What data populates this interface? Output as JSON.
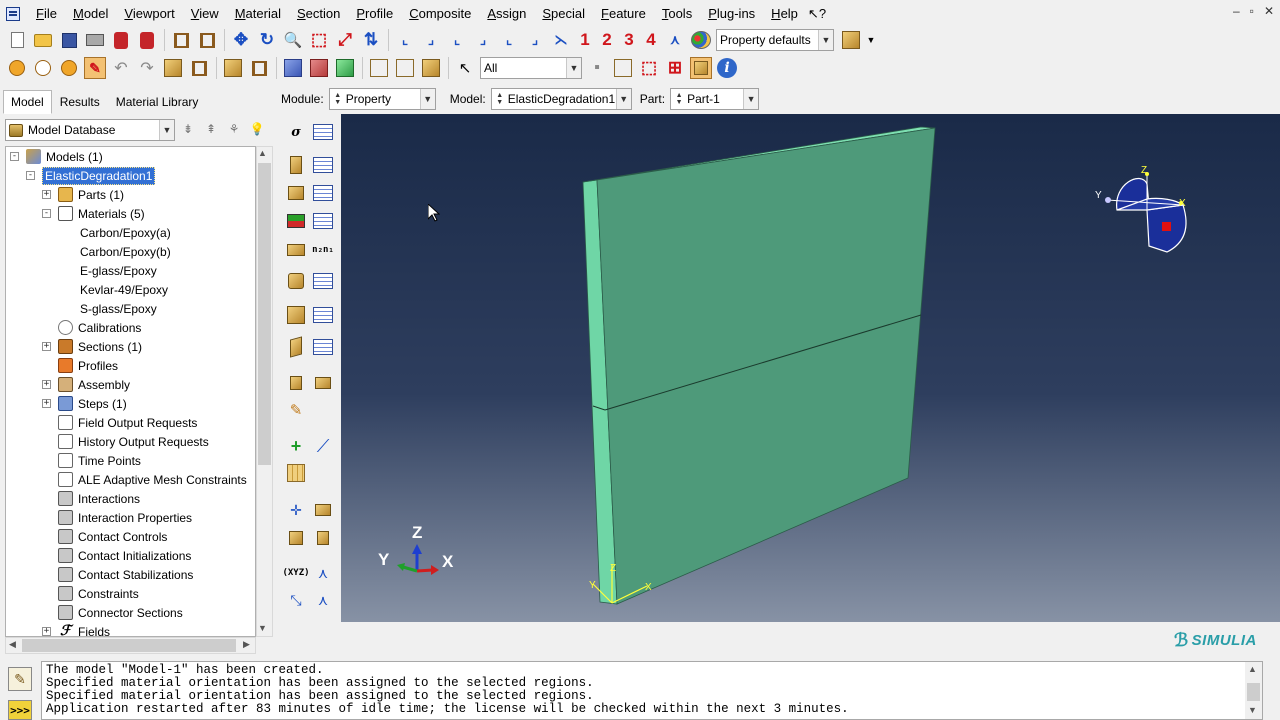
{
  "window": {
    "controls": [
      "–",
      "▫",
      "✕"
    ]
  },
  "menu": {
    "items": [
      "File",
      "Model",
      "Viewport",
      "View",
      "Material",
      "Section",
      "Profile",
      "Composite",
      "Assign",
      "Special",
      "Feature",
      "Tools",
      "Plug-ins",
      "Help"
    ],
    "help_arrow": "?"
  },
  "toolbar1": {
    "number_buttons": [
      "1",
      "2",
      "3",
      "4"
    ],
    "render_style": "Property defaults"
  },
  "toolbar2": {
    "selection_filter": "All"
  },
  "left_panel": {
    "tabs": [
      "Model",
      "Results",
      "Material Library"
    ],
    "active_tab": 0,
    "database_combo": "Model Database"
  },
  "tree": {
    "nodes": [
      {
        "label": "Models (1)",
        "level": 0,
        "expander": "-",
        "icon": "models"
      },
      {
        "label": "ElasticDegradation1",
        "level": 1,
        "expander": "-",
        "icon": "",
        "selected": true
      },
      {
        "label": "Parts (1)",
        "level": 2,
        "expander": "+",
        "icon": "parts"
      },
      {
        "label": "Materials (5)",
        "level": 2,
        "expander": "-",
        "icon": "materials"
      },
      {
        "label": "Carbon/Epoxy(a)",
        "level": 3,
        "expander": "",
        "icon": ""
      },
      {
        "label": "Carbon/Epoxy(b)",
        "level": 3,
        "expander": "",
        "icon": ""
      },
      {
        "label": "E-glass/Epoxy",
        "level": 3,
        "expander": "",
        "icon": ""
      },
      {
        "label": "Kevlar-49/Epoxy",
        "level": 3,
        "expander": "",
        "icon": ""
      },
      {
        "label": "S-glass/Epoxy",
        "level": 3,
        "expander": "",
        "icon": ""
      },
      {
        "label": "Calibrations",
        "level": 2,
        "expander": "",
        "icon": "calib"
      },
      {
        "label": "Sections (1)",
        "level": 2,
        "expander": "+",
        "icon": "sections"
      },
      {
        "label": "Profiles",
        "level": 2,
        "expander": "",
        "icon": "profiles"
      },
      {
        "label": "Assembly",
        "level": 2,
        "expander": "+",
        "icon": "assembly"
      },
      {
        "label": "Steps (1)",
        "level": 2,
        "expander": "+",
        "icon": "steps"
      },
      {
        "label": "Field Output Requests",
        "level": 2,
        "expander": "",
        "icon": "doc"
      },
      {
        "label": "History Output Requests",
        "level": 2,
        "expander": "",
        "icon": "doc"
      },
      {
        "label": "Time Points",
        "level": 2,
        "expander": "",
        "icon": "doc"
      },
      {
        "label": "ALE Adaptive Mesh Constraints",
        "level": 2,
        "expander": "",
        "icon": "doc"
      },
      {
        "label": "Interactions",
        "level": 2,
        "expander": "",
        "icon": "inter"
      },
      {
        "label": "Interaction Properties",
        "level": 2,
        "expander": "",
        "icon": "inter"
      },
      {
        "label": "Contact Controls",
        "level": 2,
        "expander": "",
        "icon": "inter"
      },
      {
        "label": "Contact Initializations",
        "level": 2,
        "expander": "",
        "icon": "inter"
      },
      {
        "label": "Contact Stabilizations",
        "level": 2,
        "expander": "",
        "icon": "inter"
      },
      {
        "label": "Constraints",
        "level": 2,
        "expander": "",
        "icon": "inter"
      },
      {
        "label": "Connector Sections",
        "level": 2,
        "expander": "",
        "icon": "inter"
      },
      {
        "label": "Fields",
        "level": 2,
        "expander": "+",
        "icon": "fields"
      }
    ]
  },
  "context": {
    "module_label": "Module:",
    "module_value": "Property",
    "model_label": "Model:",
    "model_value": "ElasticDegradation1",
    "part_label": "Part:",
    "part_value": "Part-1"
  },
  "viewport": {
    "triad_labels": {
      "z": "Z",
      "y": "Y",
      "x": "X"
    },
    "local_csys_labels": {
      "z": "Z",
      "y": "Y",
      "x": "X"
    },
    "view_manipulator_labels": {
      "z": "Z",
      "y": "Y",
      "x": "X"
    },
    "part_color": "#4e9a7a",
    "part_edge_color": "#7ee0b2",
    "accent_yellow": "#ffff3a"
  },
  "logo": {
    "text": "SIMULIA"
  },
  "messages": [
    "The model \"Model-1\" has been created.",
    "Specified material orientation has been assigned to the selected regions.",
    "Specified material orientation has been assigned to the selected regions.",
    "Application restarted after 83 minutes of idle time; the license will be checked within the next 3 minutes."
  ],
  "msg_panel": {
    "prompt_icon": ">>>"
  }
}
